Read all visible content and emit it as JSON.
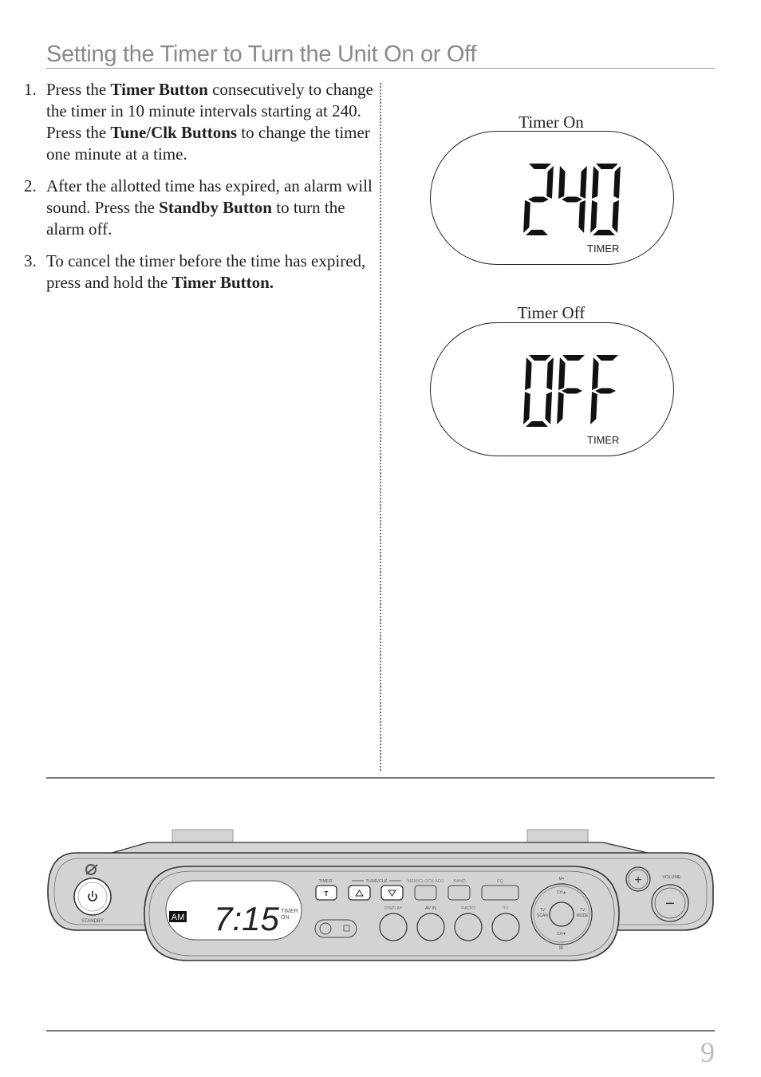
{
  "header": {
    "title": "Setting the Timer to Turn the Unit On or Off"
  },
  "steps": [
    {
      "number": "1.",
      "parts": [
        {
          "text": "Press the ",
          "bold": false
        },
        {
          "text": "Timer Button",
          "bold": true
        },
        {
          "text": " consecutively to change the timer in 10 minute intervals starting at 240.  Press the ",
          "bold": false
        },
        {
          "text": "Tune/Clk Buttons",
          "bold": true
        },
        {
          "text": " to change the timer one minute at a time.",
          "bold": false
        }
      ]
    },
    {
      "number": "2.",
      "parts": [
        {
          "text": "After the allotted time has expired, an alarm will sound.  Press the ",
          "bold": false
        },
        {
          "text": "Standby Button",
          "bold": true
        },
        {
          "text": " to turn the alarm off.",
          "bold": false
        }
      ]
    },
    {
      "number": "3.",
      "parts": [
        {
          "text": "To cancel the timer before the time has expired, press and hold the ",
          "bold": false
        },
        {
          "text": "Timer Button.",
          "bold": true
        }
      ]
    }
  ],
  "displays": [
    {
      "caption": "Timer On",
      "readout": "240",
      "indicator": "TIMER"
    },
    {
      "caption": "Timer Off",
      "readout": "OFF",
      "indicator": "TIMER"
    }
  ],
  "device": {
    "logo": "gpx-logo-icon",
    "standby_label": "STANDBY",
    "lcd": {
      "am_label": "AM",
      "time": "7:15",
      "timer_label": "TIMER",
      "on_label": "ON"
    },
    "buttons": {
      "timer_label": "TIMER",
      "timer_glyph": "T",
      "tune_clk_label": "TUNE/CLK",
      "mem_clock_label": "MEM/CLOCK ADJ.",
      "band_label": "BAND",
      "eq_label": "EQ",
      "display_label": "DISPLAY",
      "av_in_label": "AV IN",
      "radio_label": "RADIO",
      "tv_label": "TV"
    },
    "dpad": {
      "m_plus": "M+",
      "m_minus": "M-",
      "ch_up": "CH▲",
      "ch_down": "CH▼",
      "tv_scan_1": "TV",
      "tv_scan_2": "SCAN",
      "tv_mode_1": "TV",
      "tv_mode_2": "MODE"
    },
    "volume_label": "VOLUME",
    "vol_plus": "+",
    "vol_minus": "−"
  },
  "footer": {
    "page_number": "9"
  }
}
